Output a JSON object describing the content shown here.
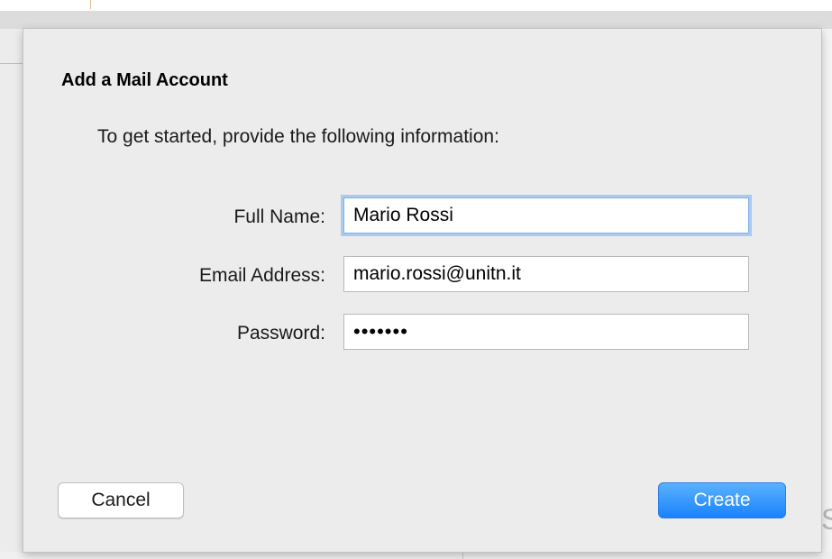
{
  "dialog": {
    "title": "Add a Mail Account",
    "subtitle": "To get started, provide the following information:"
  },
  "form": {
    "full_name": {
      "label": "Full Name:",
      "value": "Mario Rossi",
      "focused": true
    },
    "email": {
      "label": "Email Address:",
      "value": "mario.rossi@unitn.it"
    },
    "password": {
      "label": "Password:",
      "masked_value": "•••••••"
    }
  },
  "buttons": {
    "cancel_label": "Cancel",
    "create_label": "Create"
  },
  "colors": {
    "sheet_background": "#ececec",
    "primary_button": "#1a82fb",
    "focus_ring": "#a9cbf1"
  },
  "background_window": {
    "peek_letter": "S"
  }
}
